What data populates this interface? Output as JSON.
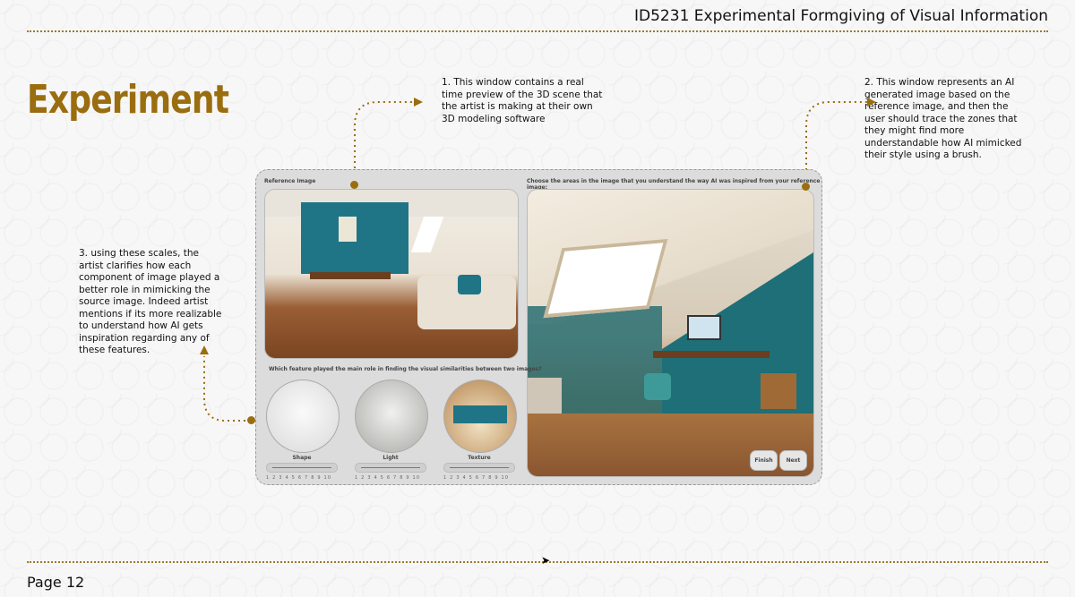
{
  "header": {
    "course_title": "ID5231 Experimental Formgiving of Visual Information"
  },
  "slide": {
    "heading": "Experiment",
    "page": "Page 12"
  },
  "notes": {
    "n1": "1. This window contains a real time preview of the 3D scene that the artist is making at their own 3D modeling software",
    "n2": "2. This window represents an AI generated image based on the reference image, and then the user should trace the zones that they might find more understandable how AI mimicked their style using a brush.",
    "n3": "3. using these scales, the artist clarifies how each component of image played a better role in mimicking the source image. Indeed artist mentions if its more realizable to understand how AI gets inspiration regarding  any of these features."
  },
  "ui": {
    "reference_label": "Reference Image",
    "ai_label": "Choose the areas in the image that you understand the way AI was inspired from your reference image:",
    "question": "Which feature played the main role in finding the visual similarities between two images?",
    "features": [
      "Shape",
      "Light",
      "Texture"
    ],
    "scale": "1 2 3 4 5 6 7 8 9 10",
    "finish_label": "Finish",
    "next_label": "Next"
  },
  "colors": {
    "accent": "#9a6d0f",
    "teal_wall": "#1f7585"
  }
}
